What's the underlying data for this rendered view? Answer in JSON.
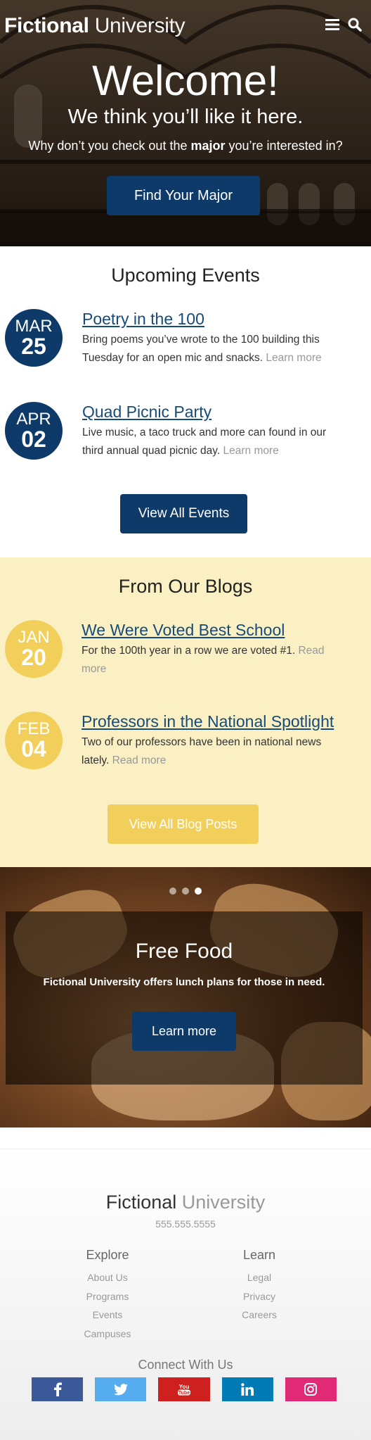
{
  "header": {
    "brand_bold": "Fictional",
    "brand_light": "University"
  },
  "hero": {
    "title": "Welcome!",
    "subtitle": "We think you’ll like it here.",
    "question_before": "Why don’t you check out the",
    "question_bold": "major",
    "question_after": "you’re interested in?",
    "button_label": "Find Your Major"
  },
  "events": {
    "title": "Upcoming Events",
    "items": [
      {
        "month": "MAR",
        "day": "25",
        "title": "Poetry in the 100",
        "description": "Bring poems you’ve wrote to the 100 building this Tuesday for an open mic and snacks.",
        "more": "Learn more"
      },
      {
        "month": "APR",
        "day": "02",
        "title": "Quad Picnic Party",
        "description": "Live music, a taco truck and more can found in our third annual quad picnic day.",
        "more": "Learn more"
      }
    ],
    "button_label": "View All Events"
  },
  "blogs": {
    "title": "From Our Blogs",
    "items": [
      {
        "month": "JAN",
        "day": "20",
        "title": "We Were Voted Best School",
        "description": "For the 100th year in a row we are voted #1.",
        "more": "Read more"
      },
      {
        "month": "FEB",
        "day": "04",
        "title": "Professors in the National Spotlight",
        "description": "Two of our professors have been in national news lately.",
        "more": "Read more"
      }
    ],
    "button_label": "View All Blog Posts"
  },
  "slider": {
    "active_slide": 3,
    "slide_count": 3,
    "title": "Free Food",
    "text": "Fictional University offers lunch plans for those in need.",
    "button_label": "Learn more"
  },
  "footer": {
    "brand_bold": "Fictional",
    "brand_light": "University",
    "phone": "555.555.5555",
    "explore": {
      "heading": "Explore",
      "links": [
        "About Us",
        "Programs",
        "Events",
        "Campuses"
      ]
    },
    "learn": {
      "heading": "Learn",
      "links": [
        "Legal",
        "Privacy",
        "Careers"
      ]
    },
    "connect_heading": "Connect With Us",
    "social": [
      {
        "name": "facebook-icon",
        "color": "#3b5998"
      },
      {
        "name": "twitter-icon",
        "color": "#55acee"
      },
      {
        "name": "youtube-icon",
        "color": "#cd201f"
      },
      {
        "name": "linkedin-icon",
        "color": "#007bb6"
      },
      {
        "name": "instagram-icon",
        "color": "#e02a75"
      }
    ]
  },
  "colors": {
    "primary_blue": "#0e3a6a",
    "accent_yellow": "#f2cf5a",
    "blog_background": "#faf0c4"
  }
}
